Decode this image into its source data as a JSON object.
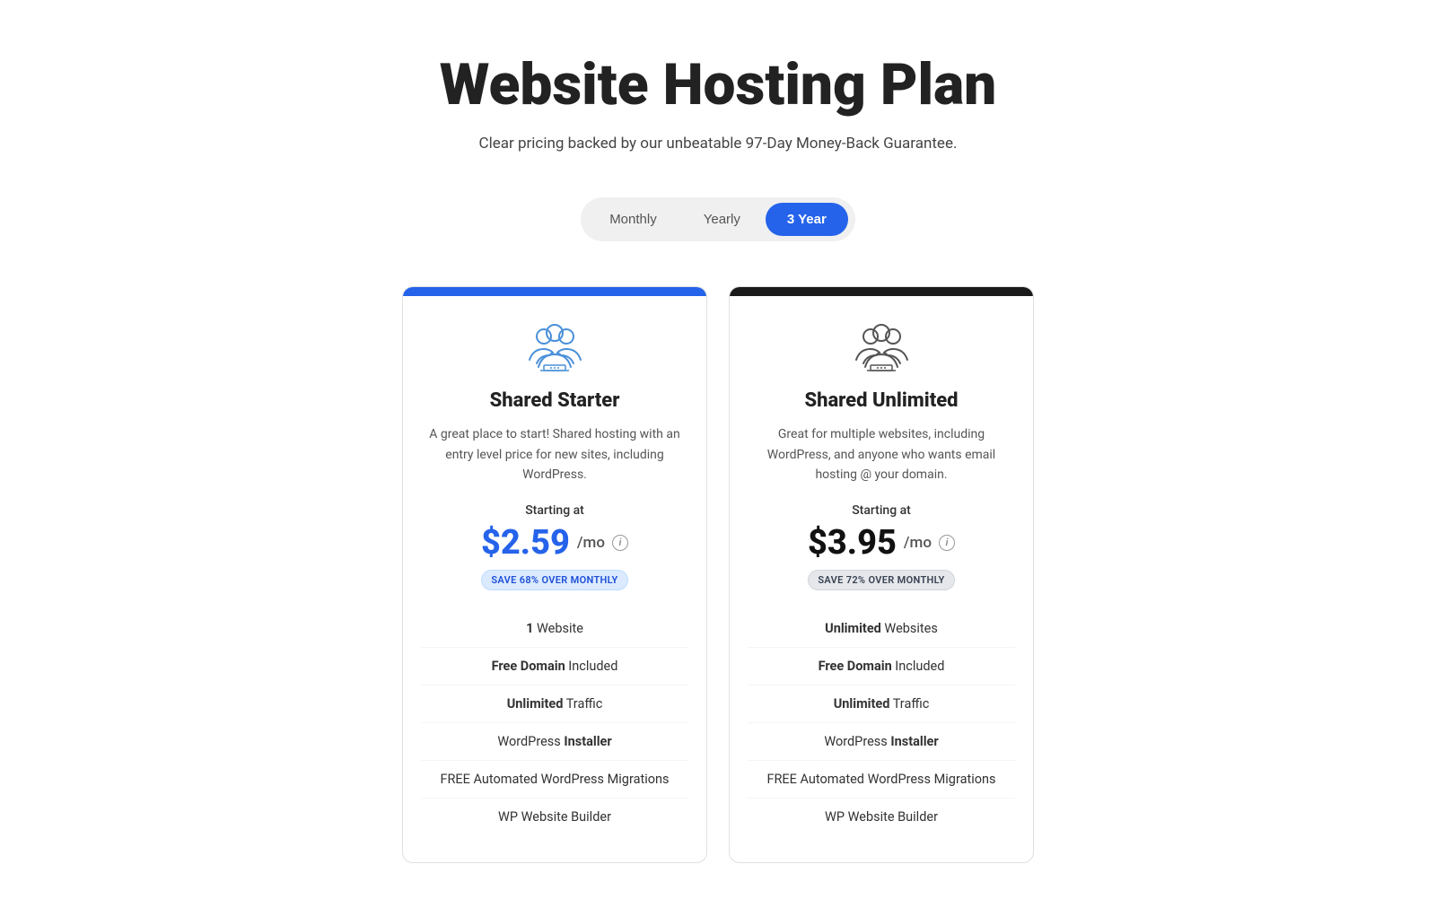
{
  "page": {
    "title": "Website Hosting Plan",
    "subtitle": "Clear pricing backed by our unbeatable 97-Day Money-Back Guarantee.",
    "toggle": {
      "options": [
        "Monthly",
        "Yearly",
        "3 Year"
      ],
      "active": "3 Year"
    }
  },
  "plans": [
    {
      "id": "starter",
      "name": "Shared Starter",
      "description": "A great place to start! Shared hosting with an entry level price for new sites, including WordPress.",
      "starting_at": "Starting at",
      "price": "$2.59",
      "period": "/mo",
      "save_badge": "SAVE 68% OVER MONTHLY",
      "features": [
        {
          "bold": "1",
          "text": " Website"
        },
        {
          "bold": "Free Domain",
          "text": " Included"
        },
        {
          "bold": "Unlimited",
          "text": " Traffic"
        },
        {
          "text": "WordPress ",
          "bold2": "Installer"
        },
        {
          "text": "FREE Automated WordPress Migrations"
        },
        {
          "text": "WP Website Builder"
        }
      ]
    },
    {
      "id": "unlimited",
      "name": "Shared Unlimited",
      "description": "Great for multiple websites, including WordPress, and anyone who wants email hosting @ your domain.",
      "starting_at": "Starting at",
      "price": "$3.95",
      "period": "/mo",
      "save_badge": "SAVE 72% OVER MONTHLY",
      "features": [
        {
          "bold": "Unlimited",
          "text": " Websites"
        },
        {
          "bold": "Free Domain",
          "text": " Included"
        },
        {
          "bold": "Unlimited",
          "text": " Traffic"
        },
        {
          "text": "WordPress ",
          "bold2": "Installer"
        },
        {
          "text": "FREE Automated WordPress Migrations"
        },
        {
          "text": "WP Website Builder"
        }
      ]
    }
  ]
}
